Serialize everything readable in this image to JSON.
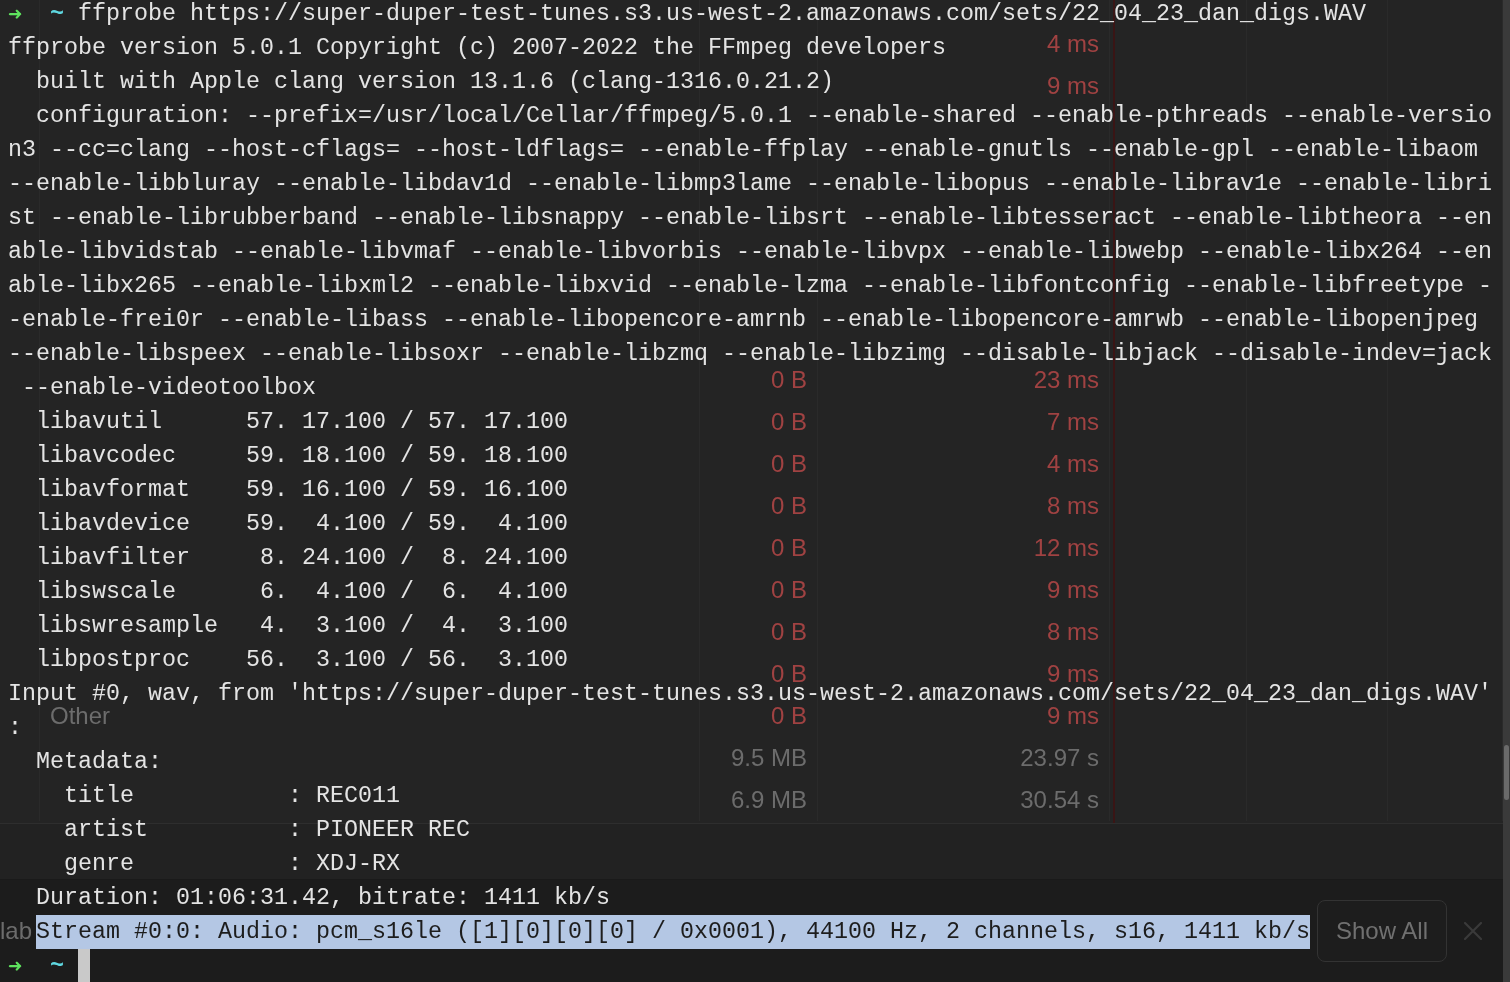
{
  "terminal": {
    "lines": [
      {
        "kind": "prompt",
        "arrow": "➜",
        "directory": "~",
        "command": "ffprobe https://super-duper-test-tunes.s3.us-west-2.amazonaws.com/sets/22_04_23_dan_digs.WAV"
      },
      {
        "kind": "output",
        "text": "ffprobe version 5.0.1 Copyright (c) 2007-2022 the FFmpeg developers"
      },
      {
        "kind": "output",
        "text": "  built with Apple clang version 13.1.6 (clang-1316.0.21.2)"
      },
      {
        "kind": "output",
        "text": "  configuration: --prefix=/usr/local/Cellar/ffmpeg/5.0.1 --enable-shared --enable-pthreads --enable-versio"
      },
      {
        "kind": "output",
        "text": "n3 --cc=clang --host-cflags= --host-ldflags= --enable-ffplay --enable-gnutls --enable-gpl --enable-libaom"
      },
      {
        "kind": "output",
        "text": "--enable-libbluray --enable-libdav1d --enable-libmp3lame --enable-libopus --enable-librav1e --enable-libri"
      },
      {
        "kind": "output",
        "text": "st --enable-librubberband --enable-libsnappy --enable-libsrt --enable-libtesseract --enable-libtheora --en"
      },
      {
        "kind": "output",
        "text": "able-libvidstab --enable-libvmaf --enable-libvorbis --enable-libvpx --enable-libwebp --enable-libx264 --en"
      },
      {
        "kind": "output",
        "text": "able-libx265 --enable-libxml2 --enable-libxvid --enable-lzma --enable-libfontconfig --enable-libfreetype -"
      },
      {
        "kind": "output",
        "text": "-enable-frei0r --enable-libass --enable-libopencore-amrnb --enable-libopencore-amrwb --enable-libopenjpeg"
      },
      {
        "kind": "output",
        "text": "--enable-libspeex --enable-libsoxr --enable-libzmq --enable-libzimg --disable-libjack --disable-indev=jack"
      },
      {
        "kind": "output",
        "text": " --enable-videotoolbox"
      },
      {
        "kind": "output",
        "text": "  libavutil      57. 17.100 / 57. 17.100"
      },
      {
        "kind": "output",
        "text": "  libavcodec     59. 18.100 / 59. 18.100"
      },
      {
        "kind": "output",
        "text": "  libavformat    59. 16.100 / 59. 16.100"
      },
      {
        "kind": "output",
        "text": "  libavdevice    59.  4.100 / 59.  4.100"
      },
      {
        "kind": "output",
        "text": "  libavfilter     8. 24.100 /  8. 24.100"
      },
      {
        "kind": "output",
        "text": "  libswscale      6.  4.100 /  6.  4.100"
      },
      {
        "kind": "output",
        "text": "  libswresample   4.  3.100 /  4.  3.100"
      },
      {
        "kind": "output",
        "text": "  libpostproc    56.  3.100 / 56.  3.100"
      },
      {
        "kind": "output",
        "text": "Input #0, wav, from 'https://super-duper-test-tunes.s3.us-west-2.amazonaws.com/sets/22_04_23_dan_digs.WAV'"
      },
      {
        "kind": "output",
        "text": ":"
      },
      {
        "kind": "output",
        "text": "  Metadata:"
      },
      {
        "kind": "output",
        "text": "    title           : REC011"
      },
      {
        "kind": "output",
        "text": "    artist          : PIONEER REC"
      },
      {
        "kind": "output",
        "text": "    genre           : XDJ-RX"
      },
      {
        "kind": "output",
        "text": "  Duration: 01:06:31.42, bitrate: 1411 kb/s"
      },
      {
        "kind": "output",
        "text": "  Stream #0:0: Audio: pcm_s16le ([1][0][0][0] / 0x0001), 44100 Hz, 2 channels, s16, 1411 kb/s",
        "highlighted": true
      },
      {
        "kind": "prompt",
        "arrow": "➜",
        "directory": "~",
        "cursor": true
      }
    ]
  },
  "background_window": {
    "rows": [
      {},
      {
        "time": "4 ms",
        "failed": true
      },
      {
        "time": "9 ms",
        "failed": true
      },
      {},
      {},
      {},
      {},
      {},
      {},
      {
        "size": "0 B",
        "time": "23 ms",
        "failed": true
      },
      {
        "size": "0 B",
        "time": "7 ms",
        "failed": true
      },
      {
        "size": "0 B",
        "time": "4 ms",
        "failed": true
      },
      {
        "size": "0 B",
        "time": "8 ms",
        "failed": true
      },
      {
        "size": "0 B",
        "time": "12 ms",
        "failed": true
      },
      {
        "size": "0 B",
        "time": "9 ms",
        "failed": true
      },
      {
        "size": "0 B",
        "time": "8 ms",
        "failed": true
      },
      {
        "size": "0 B",
        "time": "9 ms",
        "failed": true
      },
      {
        "name": "Other",
        "size": "0 B",
        "time": "9 ms",
        "failed": true
      },
      {
        "size": "9.5 MB",
        "time": "23.97 s",
        "failed": false
      },
      {
        "size": "6.9 MB",
        "time": "30.54 s",
        "failed": false
      }
    ],
    "footer_label": "lab",
    "show_all_button": "Show All"
  }
}
